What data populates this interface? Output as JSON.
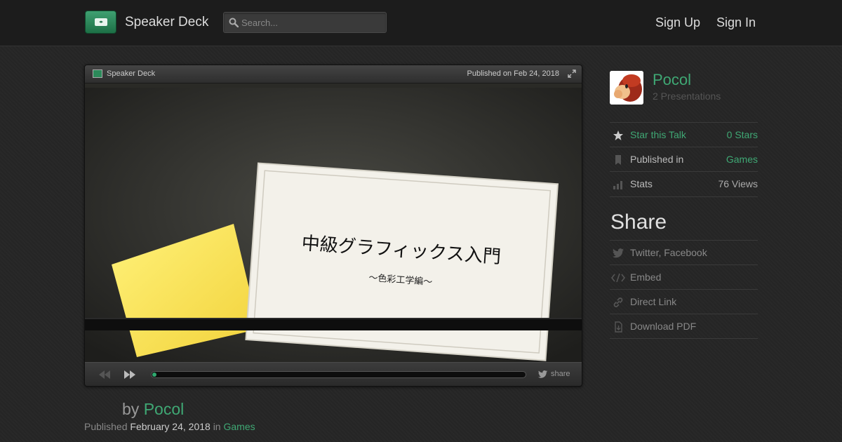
{
  "header": {
    "brand": "Speaker Deck",
    "search_placeholder": "Search...",
    "signup": "Sign Up",
    "signin": "Sign In"
  },
  "player": {
    "brand": "Speaker Deck",
    "published": "Published on Feb 24, 2018",
    "slide_title": "中級グラフィックス入門",
    "slide_subtitle": "〜色彩工学編〜",
    "progress": 0.01,
    "share_label": "share"
  },
  "talk": {
    "by": "by",
    "author": "Pocol",
    "published_prefix": "Published",
    "date": "February 24, 2018",
    "in": "in",
    "category": "Games"
  },
  "sidebar": {
    "author": "Pocol",
    "presentations": "2 Presentations",
    "star_label": "Star this Talk",
    "star_count": "0 Stars",
    "published_in_label": "Published in",
    "published_in_value": "Games",
    "stats_label": "Stats",
    "stats_value": "76 Views",
    "share_heading": "Share",
    "share_items": [
      "Twitter, Facebook",
      "Embed",
      "Direct Link",
      "Download PDF"
    ]
  },
  "colors": {
    "accent": "#3fa874",
    "background": "#262626",
    "header": "#1c1c1c"
  }
}
